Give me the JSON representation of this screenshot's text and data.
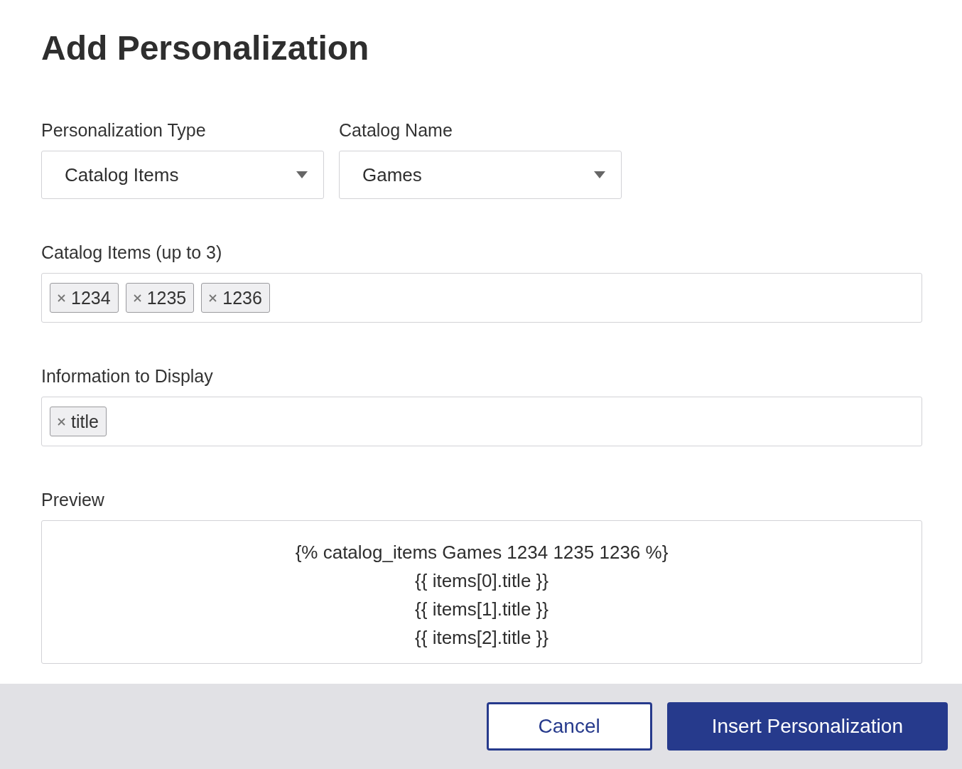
{
  "title": "Add Personalization",
  "personalization_type": {
    "label": "Personalization Type",
    "value": "Catalog Items"
  },
  "catalog_name": {
    "label": "Catalog Name",
    "value": "Games"
  },
  "catalog_items": {
    "label": "Catalog Items (up to 3)",
    "tags": [
      "1234",
      "1235",
      "1236"
    ]
  },
  "information_to_display": {
    "label": "Information to Display",
    "tags": [
      "title"
    ]
  },
  "preview": {
    "label": "Preview",
    "lines": [
      "{% catalog_items Games 1234 1235 1236 %}",
      "{{ items[0].title }}",
      "{{ items[1].title }}",
      "{{ items[2].title }}"
    ]
  },
  "buttons": [
    {
      "label": "Cancel",
      "kind": "secondary"
    },
    {
      "label": "Insert Personalization",
      "kind": "primary"
    }
  ]
}
